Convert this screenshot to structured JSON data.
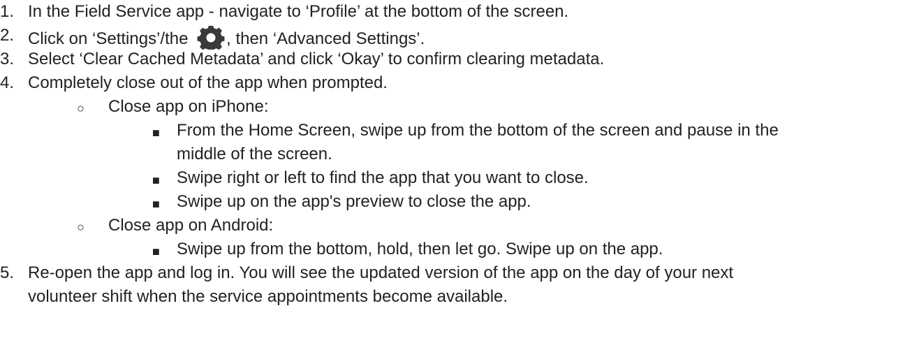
{
  "steps": [
    {
      "num": "1.",
      "text": "In the Field Service app - navigate to ‘Profile’ at the bottom of the screen."
    },
    {
      "num": "2.",
      "text_before": "Click on ‘Settings’/the ",
      "icon": "gear-icon",
      "text_after": ", then ‘Advanced Settings’."
    },
    {
      "num": "3.",
      "text": "Select ‘Clear Cached Metadata’ and click ‘Okay’ to confirm clearing metadata."
    },
    {
      "num": "4.",
      "text": "Completely close out of the app when prompted."
    },
    {
      "num": "5.",
      "text_line1": "Re-open the app and log in. You will see the updated version of the app on the day of your next",
      "text_line2": "volunteer shift when the service appointments become available."
    }
  ],
  "substeps": {
    "iphone": {
      "bullet": "○",
      "label": "Close app on iPhone:",
      "items": [
        {
          "bullet": "■",
          "line1": "From the Home Screen, swipe up from the bottom of the screen and pause in the",
          "line2": "middle of the screen."
        },
        {
          "bullet": "■",
          "line1": "Swipe right or left to find the app that you want to close."
        },
        {
          "bullet": "■",
          "line1": "Swipe up on the app's preview to close the app."
        }
      ]
    },
    "android": {
      "bullet": "○",
      "label": "Close app on Android:",
      "items": [
        {
          "bullet": "■",
          "line1": "Swipe up from the bottom, hold, then let go. Swipe up on the app."
        }
      ]
    }
  }
}
